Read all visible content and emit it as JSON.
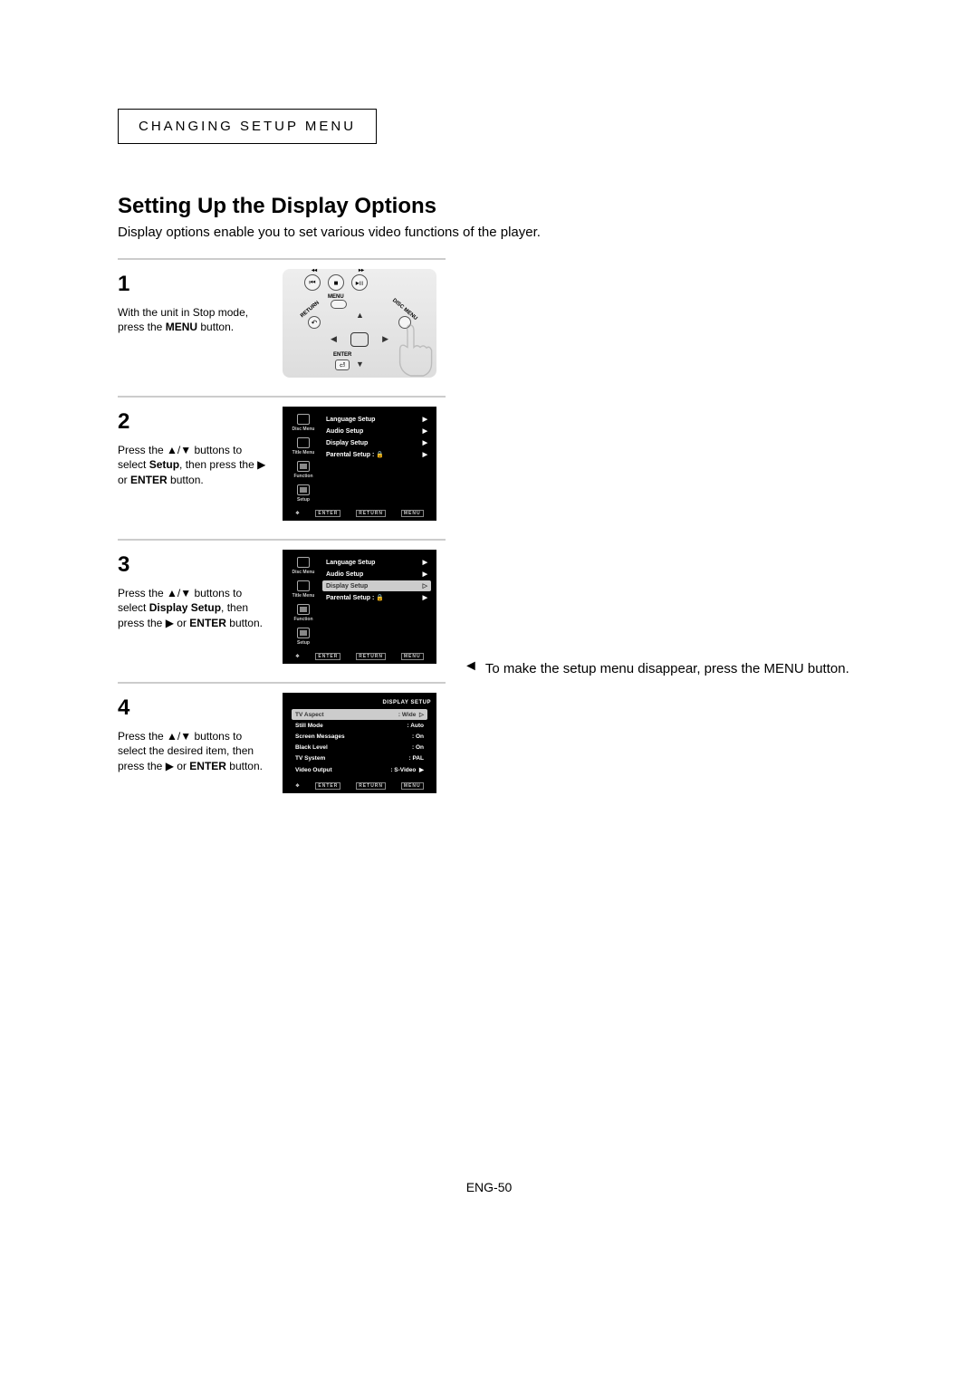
{
  "header": "CHANGING SETUP MENU",
  "title": "Setting Up the Display Options",
  "subtitle": "Display options enable you to set various video functions of the player.",
  "footer": "ENG-50",
  "steps": {
    "s1": {
      "num": "1",
      "text_a": "With the unit in Stop mode, press the ",
      "text_b": "MENU",
      "text_c": " button."
    },
    "s2": {
      "num": "2",
      "text_a": "Press the ",
      "text_b": " buttons to select ",
      "text_c": "Setup",
      "text_d": ", then press the ",
      "text_e": " or ",
      "text_f": "ENTER",
      "text_g": " button."
    },
    "s3": {
      "num": "3",
      "text_a": "Press the ",
      "text_b": " buttons to select ",
      "text_c": "Display Setup",
      "text_d": ", then press the ",
      "text_e": " or ",
      "text_f": "ENTER",
      "text_g": " button."
    },
    "s4": {
      "num": "4",
      "text_a": "Press the ",
      "text_b": " buttons to select the desired item, then press the ",
      "text_e": " or ",
      "text_f": "ENTER",
      "text_g": " button."
    }
  },
  "remote": {
    "menu": "MENU",
    "enter": "ENTER",
    "return": "RETURN",
    "discmenu": "DISC MENU"
  },
  "setup_menu": {
    "side": {
      "disc_menu": "Disc Menu",
      "title_menu": "Title Menu",
      "function": "Function",
      "setup": "Setup"
    },
    "items": {
      "language": "Language Setup",
      "audio": "Audio Setup",
      "display": "Display Setup",
      "parental": "Parental Setup :"
    },
    "footer": {
      "enter": "ENTER",
      "return": "RETURN",
      "menu": "MENU"
    }
  },
  "display_setup": {
    "title": "DISPLAY SETUP",
    "rows": {
      "tv_aspect": {
        "k": "TV Aspect",
        "v": ": Wide"
      },
      "still_mode": {
        "k": "Still Mode",
        "v": ": Auto"
      },
      "screen_msg": {
        "k": "Screen Messages",
        "v": ": On"
      },
      "black_level": {
        "k": "Black Level",
        "v": ": On"
      },
      "tv_system": {
        "k": "TV System",
        "v": ": PAL"
      },
      "video_output": {
        "k": "Video Output",
        "v": ": S-Video"
      }
    }
  },
  "note": "To make the setup menu disappear, press the MENU button."
}
